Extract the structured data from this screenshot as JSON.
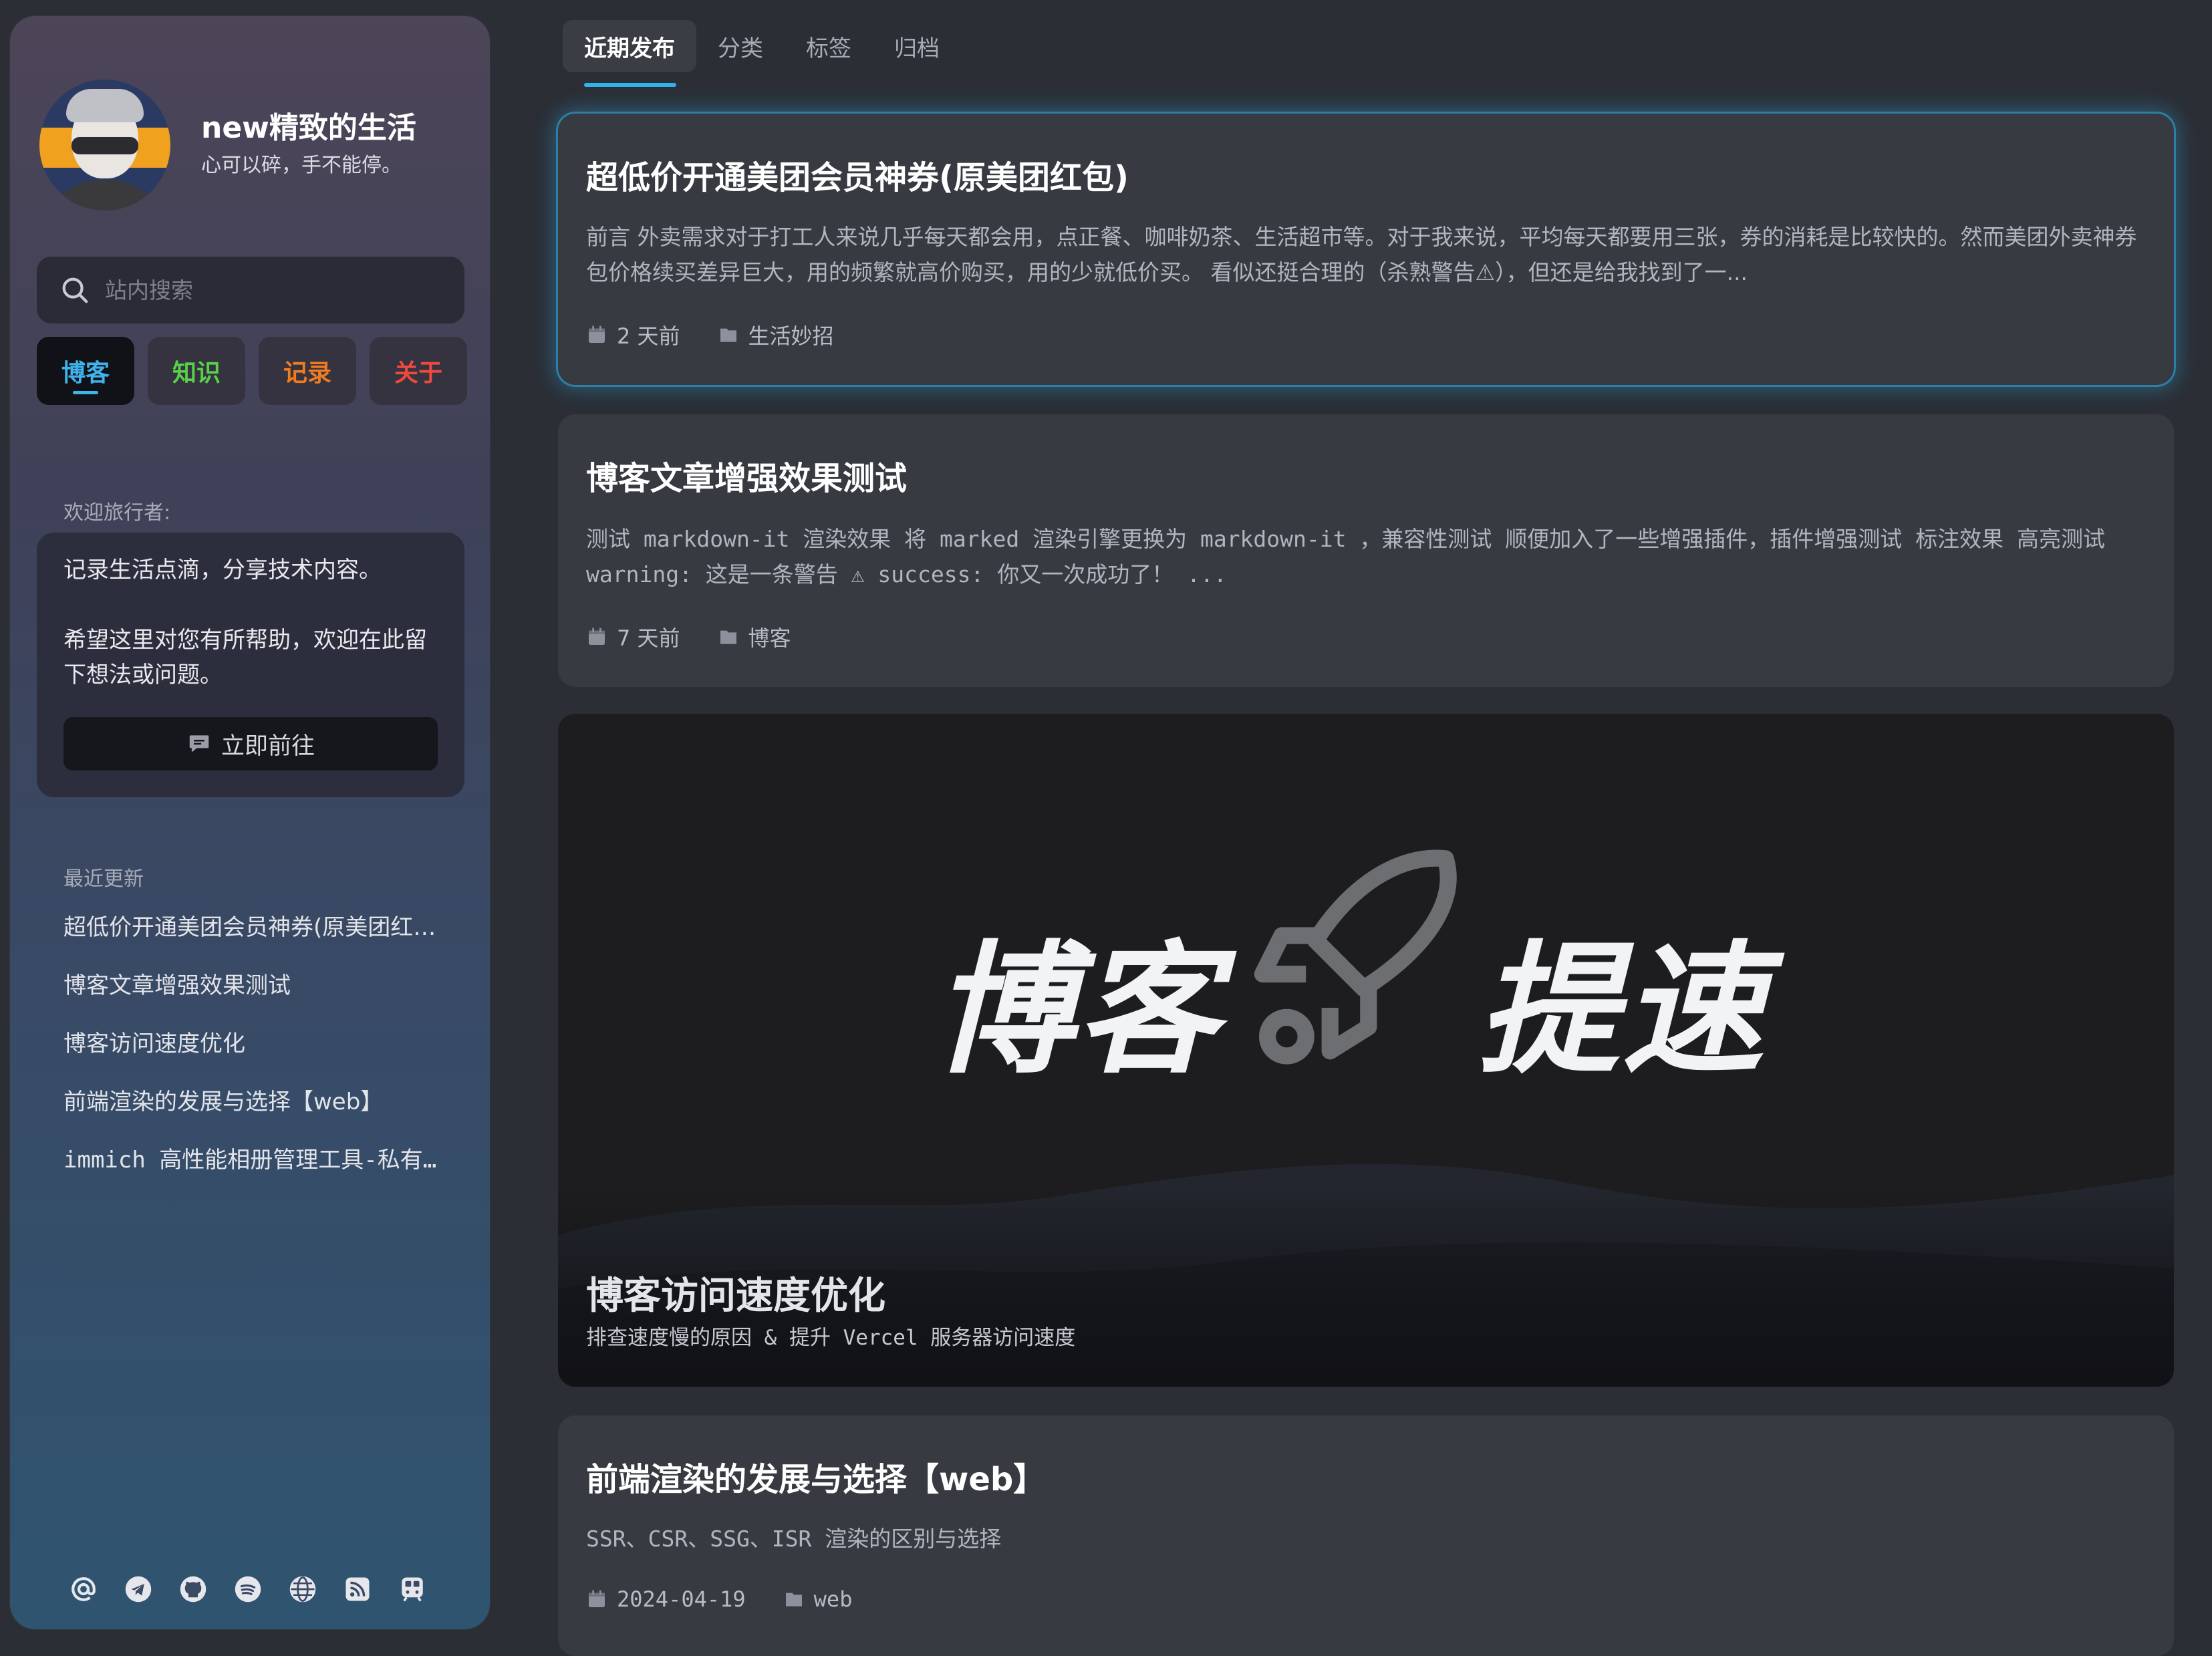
{
  "profile": {
    "site_name": "new精致的生活",
    "motto": "心可以碎，手不能停。"
  },
  "search": {
    "placeholder": "站内搜索"
  },
  "nav": {
    "items": [
      {
        "label": "博客",
        "color": "#3fb3ec",
        "active": true
      },
      {
        "label": "知识",
        "color": "#58d04a"
      },
      {
        "label": "记录",
        "color": "#f07c1f"
      },
      {
        "label": "关于",
        "color": "#f04a3e"
      }
    ]
  },
  "welcome": {
    "label": "欢迎旅行者:",
    "line1": "记录生活点滴，分享技术内容。",
    "line2": "希望这里对您有所帮助，欢迎在此留下想法或问题。",
    "button": "立即前往"
  },
  "recent": {
    "label": "最近更新",
    "items": [
      "超低价开通美团会员神券(原美团红包)",
      "博客文章增强效果测试",
      "博客访问速度优化",
      "前端渲染的发展与选择【web】",
      "immich 高性能相册管理工具-私有化部署"
    ]
  },
  "social": [
    "at-icon",
    "telegram-icon",
    "github-icon",
    "spotify-icon",
    "globe-icon",
    "rss-icon",
    "subway-icon"
  ],
  "tabs": [
    "近期发布",
    "分类",
    "标签",
    "归档"
  ],
  "posts": [
    {
      "title": "超低价开通美团会员神券(原美团红包)",
      "excerpt": "前言 外卖需求对于打工人来说几乎每天都会用，点正餐、咖啡奶茶、生活超市等。对于我来说，平均每天都要用三张，券的消耗是比较快的。然而美团外卖神券包价格续买差异巨大，用的频繁就高价购买，用的少就低价买。 看似还挺合理的（杀熟警告⚠），但还是给我找到了一...",
      "time": "2 天前",
      "category": "生活妙招"
    },
    {
      "title": "博客文章增强效果测试",
      "excerpt": "测试 markdown-it 渲染效果 将 marked 渲染引擎更换为 markdown-it ，兼容性测试 顺便加入了一些增强插件，插件增强测试 标注效果 高亮测试 warning: 这是一条警告 ⚠ success: 你又一次成功了！ ...",
      "time": "7 天前",
      "category": "博客"
    },
    {
      "title": "前端渲染的发展与选择【web】",
      "excerpt": "SSR、CSR、SSG、ISR 渲染的区别与选择",
      "time": "2024-04-19",
      "category": "web"
    }
  ],
  "cover_post": {
    "cover_word_left": "博客",
    "cover_word_right": "提速",
    "title": "博客访问速度优化",
    "subtitle": "排查速度慢的原因 & 提升 Vercel 服务器访问速度"
  }
}
